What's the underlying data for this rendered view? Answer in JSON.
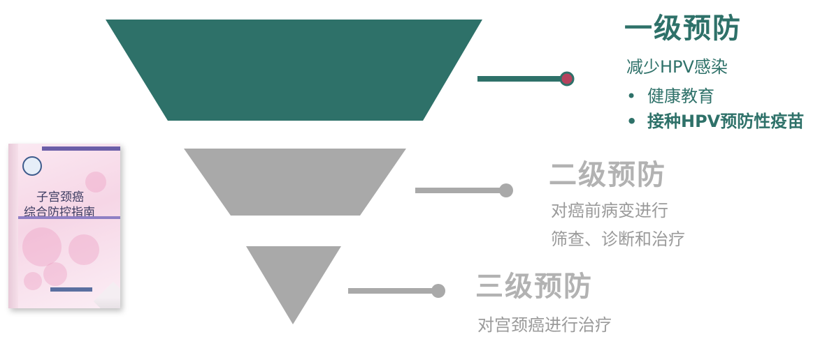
{
  "colors": {
    "level1": "#2e7169",
    "inactive": "#a9a9a9",
    "inactive_text": "#9a9a9a",
    "connector_dot_fill": "#b5425d"
  },
  "levels": [
    {
      "title": "一级预防",
      "lines": [
        "减少HPV感染"
      ],
      "bullets": [
        "健康教育",
        "接种HPV预防性疫苗"
      ]
    },
    {
      "title": "二级预防",
      "lines": [
        "对癌前病变进行",
        "筛查、诊断和治疗"
      ]
    },
    {
      "title": "三级预防",
      "lines": [
        "对宫颈癌进行治疗"
      ]
    }
  ],
  "bullet_glyph": "•",
  "book": {
    "title_line1": "子宫颈癌",
    "title_line2": "综合防控指南"
  }
}
